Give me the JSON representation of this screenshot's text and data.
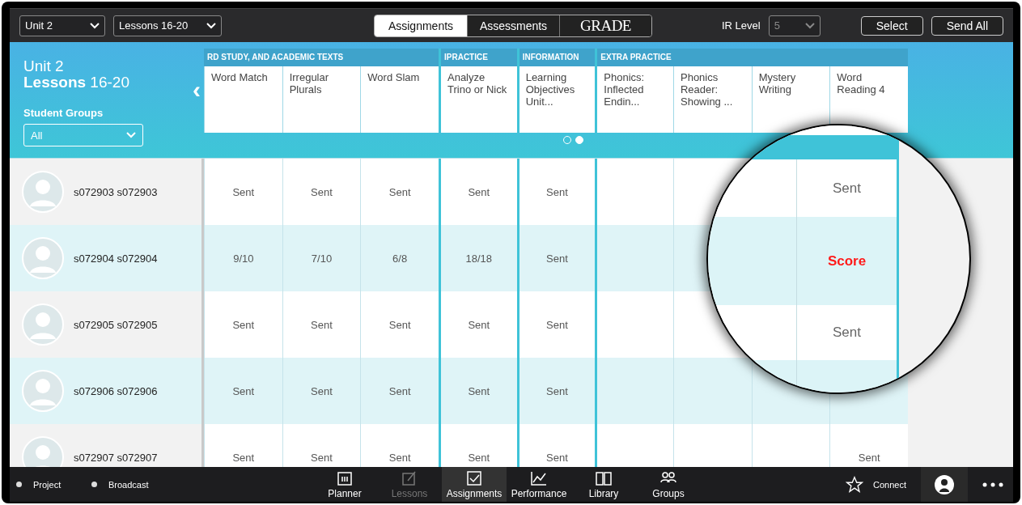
{
  "top_bar": {
    "unit_select": "Unit 2",
    "lessons_select": "Lessons 16-20",
    "tabs": [
      {
        "label": "Assignments",
        "selected": true,
        "kind": "text"
      },
      {
        "label": "Assessments",
        "selected": false,
        "kind": "text"
      },
      {
        "label": "GRADE",
        "selected": false,
        "kind": "logo"
      }
    ],
    "ir_level": {
      "label": "IR Level",
      "value": "5",
      "disabled": true
    },
    "buttons": [
      "Select",
      "Send All"
    ]
  },
  "header": {
    "title": "Unit 2",
    "subtitle": "**Lessons** 16-20",
    "groups_label": "Student Groups",
    "groups_select": "All",
    "back_arrow": "‹",
    "column_groups": [
      "RD STUDY, AND ACADEMIC TEXTS",
      "IPRACTICE",
      "INFORMATION",
      "EXTRA PRACTICE"
    ],
    "columns": [
      "Word Match",
      "Irregular Plurals",
      "Word Slam",
      "Analyze Trino or Nick",
      "Learning Objectives Unit...",
      "Phonics: Inflected Endin...",
      "Phonics Reader: Showing ...",
      "Mystery Writing",
      "Word Reading 4"
    ],
    "pager": [
      {
        "selected": false
      },
      {
        "selected": true
      }
    ]
  },
  "rows": [
    {
      "name": "s072903 s072903",
      "cells": [
        "Sent",
        "Sent",
        "Sent",
        "Sent",
        "Sent",
        null,
        null,
        null,
        null
      ]
    },
    {
      "name": "s072904 s072904",
      "cells": [
        "9/10",
        "7/10",
        "6/8",
        "18/18",
        "Sent",
        null,
        null,
        null,
        null
      ]
    },
    {
      "name": "s072905 s072905",
      "cells": [
        "Sent",
        "Sent",
        "Sent",
        "Sent",
        "Sent",
        null,
        null,
        null,
        null
      ]
    },
    {
      "name": "s072906 s072906",
      "cells": [
        "Sent",
        "Sent",
        "Sent",
        "Sent",
        "Sent",
        null,
        null,
        null,
        null
      ]
    },
    {
      "name": "s072907 s072907",
      "cells": [
        "Sent",
        "Sent",
        "Sent",
        "Sent",
        "Sent",
        null,
        null,
        null,
        "Sent"
      ]
    }
  ],
  "magnifier": {
    "cells": [
      {
        "text": "Sent",
        "kind": "normal"
      },
      {
        "text": "Score",
        "kind": "alert"
      },
      {
        "text": "Sent",
        "kind": "normal"
      }
    ]
  },
  "bottom_bar": {
    "left": [
      "Project",
      "Broadcast"
    ],
    "nav": [
      {
        "label": "Planner",
        "selected": false,
        "disabled": false
      },
      {
        "label": "Lessons",
        "selected": false,
        "disabled": true
      },
      {
        "label": "Assignments",
        "selected": true,
        "disabled": false
      },
      {
        "label": "Performance",
        "selected": false,
        "disabled": false
      },
      {
        "label": "Library",
        "selected": false,
        "disabled": false
      },
      {
        "label": "Groups",
        "selected": false,
        "disabled": false
      }
    ],
    "connect": "Connect"
  }
}
